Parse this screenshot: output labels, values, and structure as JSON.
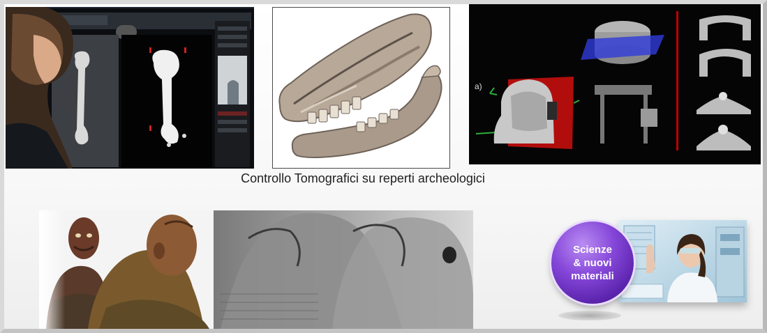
{
  "caption": "Controllo Tomografici su reperti archeologici",
  "badge": {
    "line1": "Scienze",
    "line2": "& nuovi",
    "line3": "materiali"
  },
  "images": {
    "ct_workstation": "ct-workstation-photo",
    "animal_skull": "animal-skull-ct-render",
    "sarcophagus_mask": "sarcophagus-mask-ct-slices",
    "mask_label": "a)",
    "statue_xray": "statue-xray-composite",
    "scientist": "scientist-photo"
  },
  "colors": {
    "badge_purple": "#7a3bd0",
    "dark_bg": "#050505",
    "bone": "#e6e6e6",
    "skull_tone": "#b9aa9a",
    "red_plane": "#c00000",
    "blue_plane": "#2f3bd8",
    "statue_wood": "#7a5230"
  }
}
